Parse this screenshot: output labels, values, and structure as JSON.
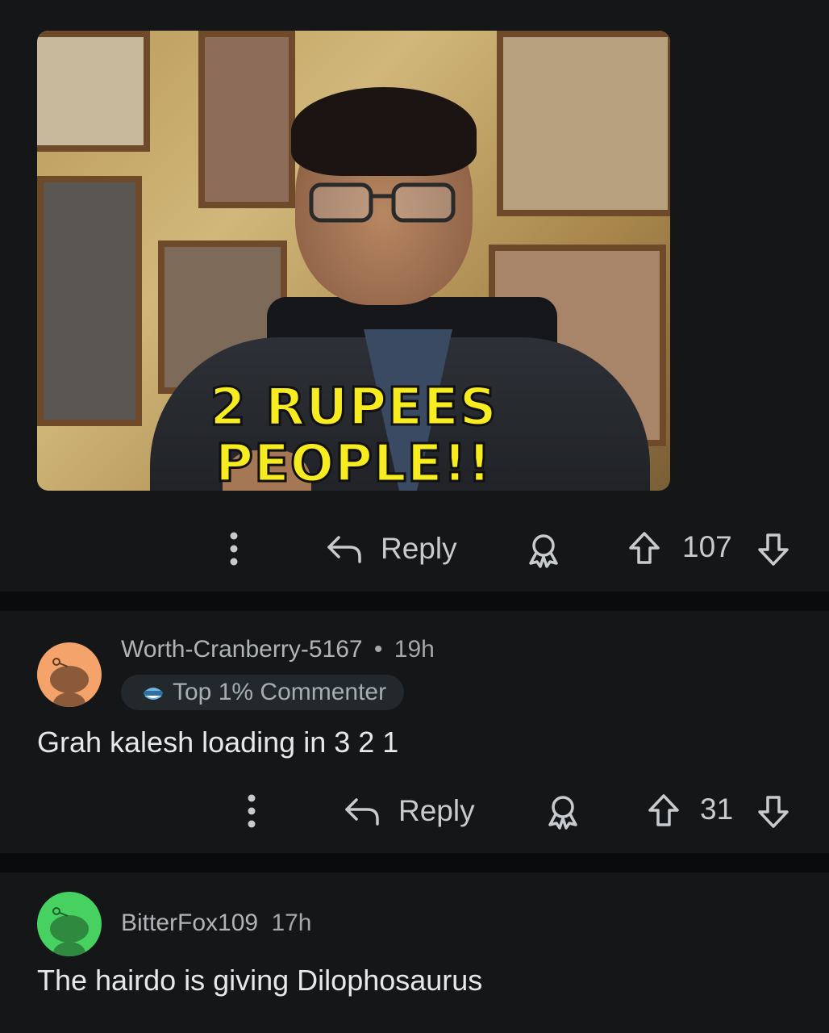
{
  "meme": {
    "caption_line1": "2 RUPEES",
    "caption_line2": "PEOPLE!!"
  },
  "comment0": {
    "reply_label": "Reply",
    "score": "107"
  },
  "comment1": {
    "username": "Worth-Cranberry-5167",
    "separator": "•",
    "age": "19h",
    "badge_label": "Top 1% Commenter",
    "avatar_color": "#f4a36b",
    "text": "Grah kalesh loading in 3 2 1",
    "reply_label": "Reply",
    "score": "31"
  },
  "comment2": {
    "username": "BitterFox109",
    "age": "17h",
    "avatar_color": "#46d160",
    "text": "The hairdo is giving Dilophosaurus"
  },
  "icons": {
    "more": "more-vertical-icon",
    "reply": "reply-arrow-icon",
    "award": "award-icon",
    "upvote": "upvote-icon",
    "downvote": "downvote-icon",
    "badge": "commenter-badge-icon"
  },
  "colors": {
    "background": "#0e1011",
    "comment_bg": "#141617",
    "caption_yellow": "#f6ec1f"
  }
}
